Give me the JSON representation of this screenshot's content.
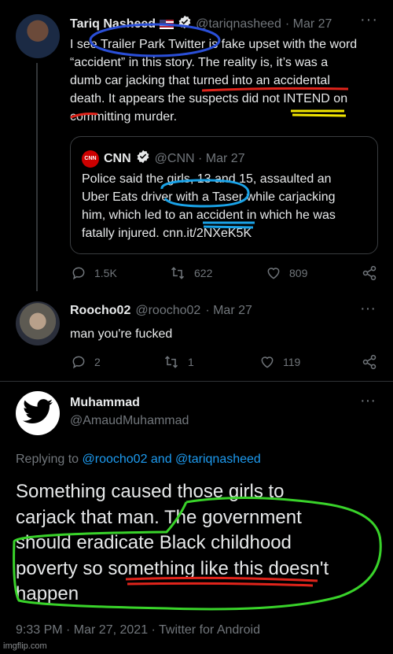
{
  "tweet1": {
    "name": "Tariq Nasheed",
    "handle": "@tariqnasheed",
    "date": "· Mar 27",
    "lines": [
      "I see Trailer Park Twitter is fake upset with the word",
      "“accident” in this story. The reality is, it’s was a",
      "dumb car jacking that turned into an accidental",
      "death. It appears the suspects did not INTEND on",
      "committing murder."
    ],
    "quote": {
      "name": "CNN",
      "handle": "@CNN · Mar 27",
      "lines": [
        "Police said the girls, 13 and 15, assaulted an",
        "Uber Eats driver with a Taser while carjacking",
        "him, which led to an accident in which he was",
        "fatally injured. cnn.it/2NXeK5K"
      ]
    },
    "replies": "1.5K",
    "retweets": "622",
    "likes": "809"
  },
  "tweet2": {
    "name": "Roocho02",
    "handle": "@roocho02",
    "date": "· Mar 27",
    "text": "man you're fucked",
    "replies": "2",
    "retweets": "1",
    "likes": "119"
  },
  "tweet3": {
    "name": "Muhammad",
    "handle": "@AmaudMuhammad",
    "replying_prefix": "Replying to ",
    "replying_users": "@roocho02 and @tariqnasheed",
    "lines": [
      "Something caused those girls to",
      "carjack that man. The government",
      "should eradicate Black childhood",
      "poverty so something like this doesn't",
      "happen"
    ],
    "meta": "9:33 PM · Mar 27, 2021 · Twitter for Android"
  },
  "watermark": "imgflip.com",
  "colors": {
    "background": "#000000",
    "link": "#1d9bf0",
    "muted": "#71767b",
    "verified": "#e7e9ea"
  }
}
